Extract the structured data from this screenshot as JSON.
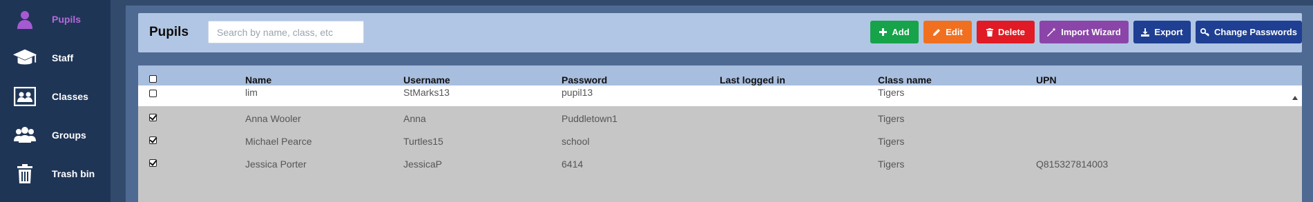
{
  "sidebar": {
    "items": [
      {
        "label": "Pupils",
        "icon": "pupil-icon",
        "active": true
      },
      {
        "label": "Staff",
        "icon": "graduation-cap-icon",
        "active": false
      },
      {
        "label": "Classes",
        "icon": "classroom-icon",
        "active": false
      },
      {
        "label": "Groups",
        "icon": "group-icon",
        "active": false
      },
      {
        "label": "Trash bin",
        "icon": "trash-icon",
        "active": false
      }
    ]
  },
  "header": {
    "title": "Pupils",
    "search_placeholder": "Search by name, class, etc",
    "search_value": ""
  },
  "toolbar": {
    "add_label": "Add",
    "edit_label": "Edit",
    "delete_label": "Delete",
    "import_label": "Import Wizard",
    "export_label": "Export",
    "change_passwords_label": "Change Passwords"
  },
  "table": {
    "columns": [
      "Name",
      "Username",
      "Password",
      "Last logged in",
      "Class name",
      "UPN"
    ],
    "rows": [
      {
        "checked": false,
        "name": "lim",
        "username": "StMarks13",
        "password": "pupil13",
        "last_logged_in": "",
        "class_name": "Tigers",
        "upn": ""
      },
      {
        "checked": true,
        "name": "Anna Wooler",
        "username": "Anna",
        "password": "Puddletown1",
        "last_logged_in": "",
        "class_name": "Tigers",
        "upn": ""
      },
      {
        "checked": true,
        "name": "Michael Pearce",
        "username": "Turtles15",
        "password": "school",
        "last_logged_in": "",
        "class_name": "Tigers",
        "upn": ""
      },
      {
        "checked": true,
        "name": "Jessica Porter",
        "username": "JessicaP",
        "password": "6414",
        "last_logged_in": "",
        "class_name": "Tigers",
        "upn": "Q815327814003"
      }
    ]
  },
  "colors": {
    "sidebar_bg": "#1f3556",
    "active_label": "#b46ad9",
    "add": "#16a34a",
    "edit": "#f07020",
    "delete": "#e01b25",
    "import": "#8b45a8",
    "export": "#1f3f93",
    "change_passwords": "#1f3f93"
  }
}
